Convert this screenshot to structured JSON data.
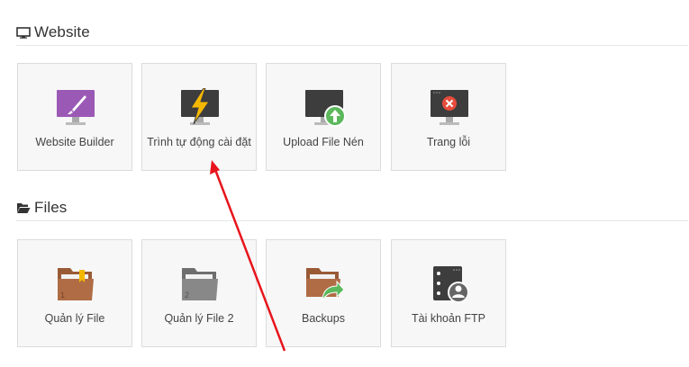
{
  "sections": [
    {
      "title": "Website",
      "icon": "monitor-icon",
      "tiles": [
        {
          "label": "Website Builder",
          "icon": "website-builder-icon"
        },
        {
          "label": "Trình tự động cài đặt",
          "icon": "auto-installer-icon"
        },
        {
          "label": "Upload File Nén",
          "icon": "upload-archive-icon"
        },
        {
          "label": "Trang lỗi",
          "icon": "error-page-icon"
        }
      ]
    },
    {
      "title": "Files",
      "icon": "folder-open-icon",
      "tiles": [
        {
          "label": "Quản lý File",
          "icon": "file-manager-icon"
        },
        {
          "label": "Quản lý File 2",
          "icon": "file-manager-2-icon"
        },
        {
          "label": "Backups",
          "icon": "backups-icon"
        },
        {
          "label": "Tài khoản FTP",
          "icon": "ftp-account-icon"
        }
      ]
    }
  ],
  "colors": {
    "annotation_arrow": "#e8141c",
    "folder_brown": "#b06c45",
    "purple": "#9b59b6",
    "green": "#5cb85c",
    "red": "#e74c3c",
    "yellow": "#f5b800",
    "gray_dark": "#3d3d3d"
  }
}
